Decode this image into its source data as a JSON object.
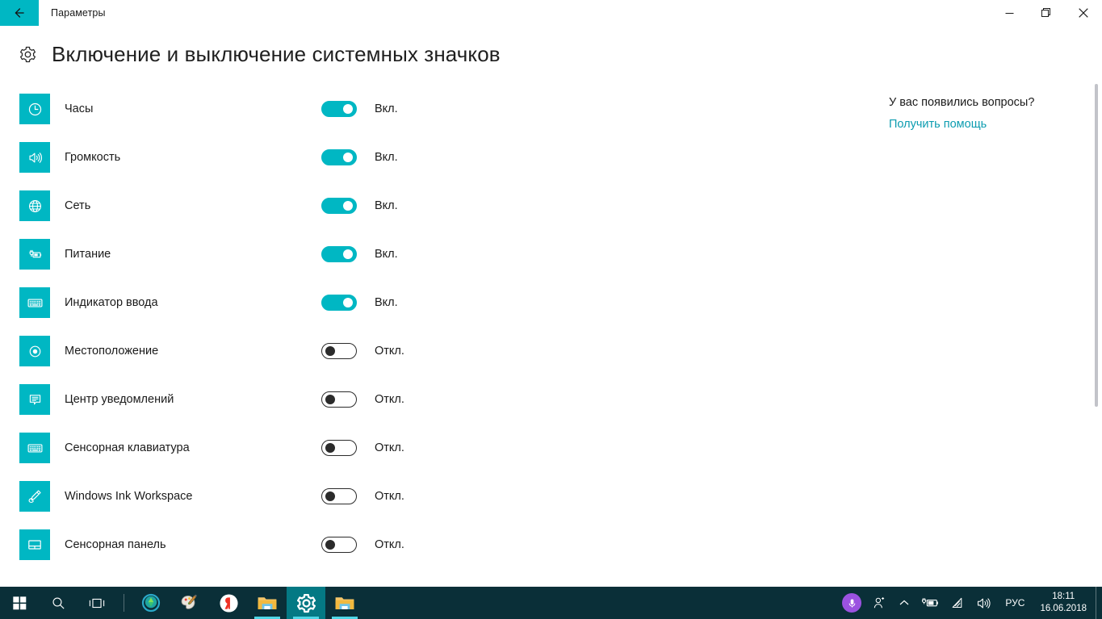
{
  "window": {
    "title": "Параметры",
    "back_icon": "back-arrow-icon",
    "minimize_label": "—",
    "maximize_label": "❐",
    "close_label": "✕"
  },
  "page": {
    "icon": "gear-icon",
    "title": "Включение и выключение системных значков"
  },
  "accent_colors": {
    "tile": "#00b7c3",
    "toggle_on": "#00b7c3",
    "link": "#0c9cb0",
    "taskbar": "#0a2f38",
    "cortana": "#9b52e0"
  },
  "settings": [
    {
      "icon": "clock-icon",
      "label": "Часы",
      "state": "on",
      "state_label": "Вкл."
    },
    {
      "icon": "volume-icon",
      "label": "Громкость",
      "state": "on",
      "state_label": "Вкл."
    },
    {
      "icon": "network-icon",
      "label": "Сеть",
      "state": "on",
      "state_label": "Вкл."
    },
    {
      "icon": "power-icon",
      "label": "Питание",
      "state": "on",
      "state_label": "Вкл."
    },
    {
      "icon": "keyboard-icon",
      "label": "Индикатор ввода",
      "state": "on",
      "state_label": "Вкл."
    },
    {
      "icon": "location-icon",
      "label": "Местоположение",
      "state": "off",
      "state_label": "Откл."
    },
    {
      "icon": "notification-icon",
      "label": "Центр уведомлений",
      "state": "off",
      "state_label": "Откл."
    },
    {
      "icon": "touch-keyboard-icon",
      "label": "Сенсорная клавиатура",
      "state": "off",
      "state_label": "Откл."
    },
    {
      "icon": "pen-icon",
      "label": "Windows Ink Workspace",
      "state": "off",
      "state_label": "Откл."
    },
    {
      "icon": "touchpad-icon",
      "label": "Сенсорная панель",
      "state": "off",
      "state_label": "Откл."
    }
  ],
  "help": {
    "question": "У вас появились вопросы?",
    "link": "Получить помощь"
  },
  "taskbar": {
    "start_icon": "windows-start-icon",
    "search_icon": "search-icon",
    "taskview_icon": "task-view-icon",
    "apps": [
      {
        "name": "globe-app-icon",
        "active": false
      },
      {
        "name": "paint-app-icon",
        "active": false
      },
      {
        "name": "yandex-browser-icon",
        "active": false
      },
      {
        "name": "file-explorer-icon",
        "active": false
      },
      {
        "name": "settings-app-icon",
        "active": true
      },
      {
        "name": "file-explorer-icon-2",
        "active": false
      }
    ],
    "tray": {
      "cortana_icon": "microphone-icon",
      "people_icon": "people-icon",
      "chevron_icon": "chevron-up-icon",
      "battery_icon": "battery-charging-icon",
      "wifi_icon": "wifi-icon",
      "volume_icon": "volume-icon",
      "language": "РУС",
      "time": "18:11",
      "date": "16.06.2018"
    }
  }
}
